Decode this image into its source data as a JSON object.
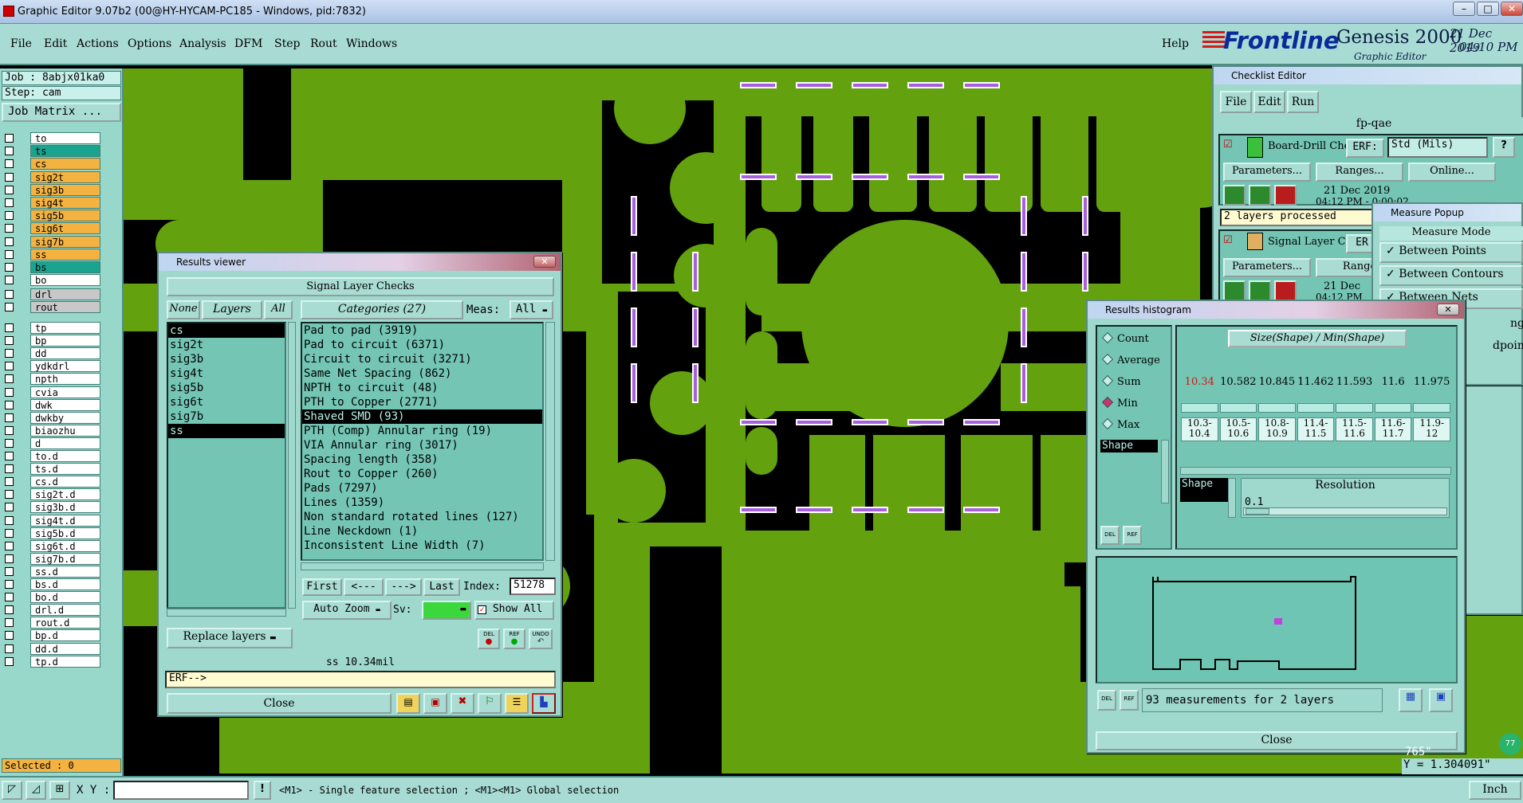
{
  "titlebar": {
    "title": "Graphic Editor 9.07b2 (00@HY-HYCAM-PC185 - Windows, pid:7832)",
    "min": "–",
    "max": "□",
    "close": "✕"
  },
  "menubar": {
    "items": [
      "File",
      "Edit",
      "Actions",
      "Options",
      "Analysis",
      "DFM",
      "Step",
      "Rout",
      "Windows"
    ],
    "help": "Help"
  },
  "brand": {
    "logo": "Frontline",
    "product": "Genesis 2000",
    "subtitle": "Graphic Editor",
    "date": "21 Dec 2019",
    "time": "04:10 PM"
  },
  "leftpanel": {
    "job": "Job : 8abjx01ka0",
    "step": "Step: cam",
    "job_matrix": "Job Matrix ...",
    "layers_a": [
      {
        "name": "to",
        "color": "#ffffff"
      },
      {
        "name": "ts",
        "color": "#1aa38f"
      },
      {
        "name": "cs",
        "color": "#f4b341"
      },
      {
        "name": "sig2t",
        "color": "#f4b341"
      },
      {
        "name": "sig3b",
        "color": "#f4b341"
      },
      {
        "name": "sig4t",
        "color": "#f4b341"
      },
      {
        "name": "sig5b",
        "color": "#f4b341"
      },
      {
        "name": "sig6t",
        "color": "#f4b341"
      },
      {
        "name": "sig7b",
        "color": "#f4b341"
      },
      {
        "name": "ss",
        "color": "#f4b341"
      },
      {
        "name": "bs",
        "color": "#1aa38f"
      },
      {
        "name": "bo",
        "color": "#ffffff"
      }
    ],
    "layers_b": [
      {
        "name": "drl",
        "color": "#c8c8c8"
      },
      {
        "name": "rout",
        "color": "#c8c8c8"
      }
    ],
    "layers_c": [
      "tp",
      "bp",
      "dd",
      "ydkdrl",
      "npth",
      "cvia",
      "dwk",
      "dwkby",
      "biaozhu",
      "d",
      "to.d",
      "ts.d",
      "cs.d",
      "sig2t.d",
      "sig3b.d",
      "sig4t.d",
      "sig5b.d",
      "sig6t.d",
      "sig7b.d",
      "ss.d",
      "bs.d",
      "bo.d",
      "drl.d",
      "rout.d",
      "bp.d",
      "dd.d",
      "tp.d"
    ],
    "selected": "Selected : 0"
  },
  "results_viewer": {
    "title": "Results viewer",
    "header": "Signal Layer Checks",
    "none": "None",
    "layers": "Layers",
    "all": "All",
    "layer_list": [
      "cs",
      "sig2t",
      "sig3b",
      "sig4t",
      "sig5b",
      "sig6t",
      "sig7b",
      "ss"
    ],
    "categories_label": "Categories (27)",
    "meas_label": "Meas:",
    "meas_value": "All",
    "categories": [
      "Pad to pad (3919)",
      "Pad to circuit (6371)",
      "Circuit to circuit (3271)",
      "Same Net Spacing (862)",
      "NPTH to circuit (48)",
      "PTH to Copper (2771)",
      "Shaved SMD (93)",
      "PTH (Comp) Annular ring (19)",
      "VIA Annular ring (3017)",
      "Spacing length (358)",
      "Rout to Copper (260)",
      "Pads (7297)",
      "Lines (1359)",
      "Non standard rotated lines (127)",
      "Line Neckdown (1)",
      "Inconsistent Line Width (7)"
    ],
    "selected_category": "Shaved SMD (93)",
    "first": "First",
    "prev": "<---",
    "next": "--->",
    "last": "Last",
    "index_label": "Index:",
    "index_value": "51278",
    "auto_zoom": "Auto Zoom",
    "sv_label": "Sv:",
    "show_all": "Show All",
    "replace_layers": "Replace layers",
    "status": "ss 10.34mil",
    "erf": "ERF-->",
    "close": "Close",
    "del": "DEL",
    "ref": "REF",
    "undo": "UNDO"
  },
  "checklist": {
    "title": "Checklist Editor",
    "menu": [
      "File",
      "Edit",
      "Run"
    ],
    "name": "fp-qae",
    "check1": "Board-Drill Che",
    "erf": "ERF:",
    "erf_value": "Std (Mils)",
    "help": "?",
    "parameters": "Parameters...",
    "ranges": "Ranges...",
    "online": "Online...",
    "date1": "21 Dec 2019",
    "time1": "04:12 PM - 0:00:02",
    "processed": "2 layers processed",
    "check2": "Signal Layer Ch",
    "erf2": "ER",
    "parameters2": "Parameters...",
    "ranges2": "Range",
    "date2": "21 Dec",
    "time2": "04:12 PM"
  },
  "measure_popup": {
    "title": "Measure Popup",
    "mode": "Measure Mode",
    "options": [
      "Between Points",
      "Between Contours",
      "Between Nets"
    ],
    "hidden_tail": [
      "ng",
      "dpoints"
    ]
  },
  "histogram": {
    "title": "Results histogram",
    "options": [
      "Count",
      "Average",
      "Sum",
      "Min",
      "Max"
    ],
    "selected_option": "Min",
    "list_item": "Shape",
    "heading": "Size(Shape) / Min(Shape)",
    "values": [
      "10.34",
      "10.582",
      "10.845",
      "11.462",
      "11.593",
      "11.6",
      "11.975"
    ],
    "ranges": [
      "10.3-\n10.4",
      "10.5-\n10.6",
      "10.8-\n10.9",
      "11.4-\n11.5",
      "11.5-\n11.6",
      "11.6-\n11.7",
      "11.9-\n12"
    ],
    "bar_heights": [
      0.6,
      0.6,
      0.6,
      0.6,
      0.6,
      0.6,
      0.6
    ],
    "shape_label": "Shape",
    "resolution_label": "Resolution",
    "resolution_value": "0.1",
    "status": "93 measurements for 2 layers",
    "close": "Close",
    "del": "DEL",
    "ref": "REF"
  },
  "statusbar": {
    "xy_label": "X Y :",
    "hint": "<M1> - Single feature selection ; <M1><M1> Global selection",
    "units": "Inch",
    "x_readout": "765\"",
    "y_readout": "Y = 1.304091\"",
    "badge": "77"
  }
}
